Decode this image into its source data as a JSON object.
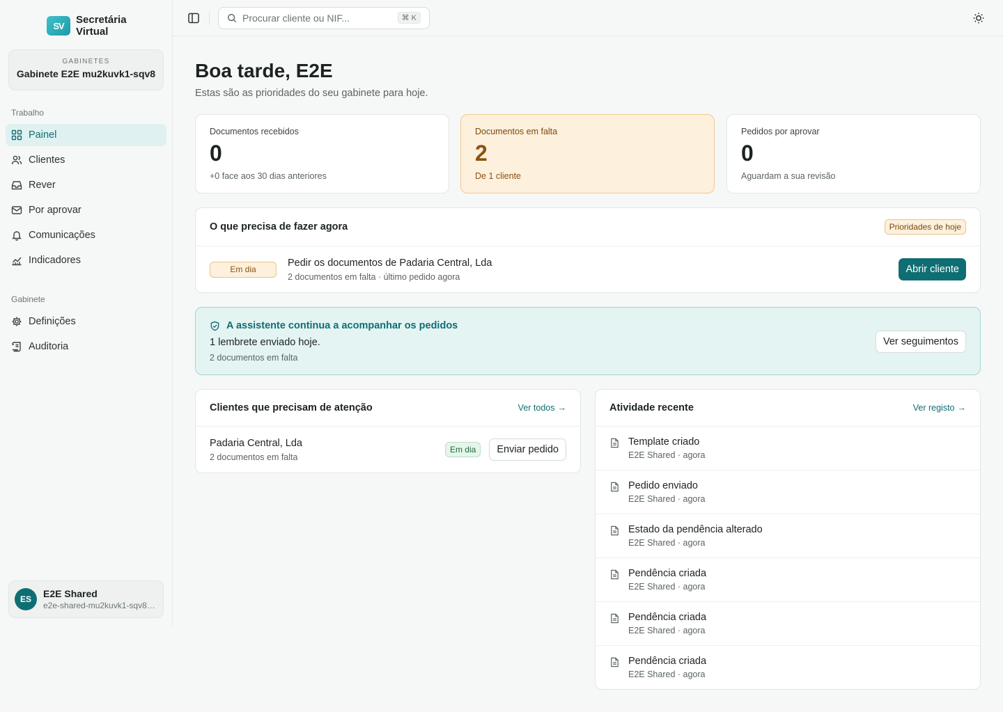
{
  "brand": {
    "logo_mark": "SV",
    "line1": "Secretária",
    "line2": "Virtual"
  },
  "office": {
    "caption": "GABINETES",
    "name": "Gabinete E2E mu2kuvk1-sqv8"
  },
  "nav": {
    "work_section": "Trabalho",
    "work_items": [
      {
        "label": "Painel",
        "icon": "grid-icon",
        "active": true
      },
      {
        "label": "Clientes",
        "icon": "users-icon"
      },
      {
        "label": "Rever",
        "icon": "inbox-icon"
      },
      {
        "label": "Por aprovar",
        "icon": "mail-icon"
      },
      {
        "label": "Comunicações",
        "icon": "bell-icon"
      },
      {
        "label": "Indicadores",
        "icon": "chart-icon"
      }
    ],
    "office_section": "Gabinete",
    "office_items": [
      {
        "label": "Definições",
        "icon": "gear-icon"
      },
      {
        "label": "Auditoria",
        "icon": "scroll-icon"
      }
    ]
  },
  "user": {
    "initials": "ES",
    "name": "E2E Shared",
    "email": "e2e-shared-mu2kuvk1-sqv8@example.com"
  },
  "header": {
    "search_placeholder": "Procurar cliente ou NIF...",
    "shortcut": "⌘ K"
  },
  "greeting": {
    "title": "Boa tarde, E2E",
    "subtitle": "Estas são as prioridades do seu gabinete para hoje."
  },
  "stats": [
    {
      "label": "Documentos recebidos",
      "value": "0",
      "hint": "+0 face aos 30 dias anteriores"
    },
    {
      "label": "Documentos em falta",
      "value": "2",
      "hint": "De 1 cliente"
    },
    {
      "label": "Pedidos por aprovar",
      "value": "0",
      "hint": "Aguardam a sua revisão"
    }
  ],
  "todo": {
    "title": "O que precisa de fazer agora",
    "badge": "Prioridades de hoje",
    "task": {
      "status": "Em dia",
      "title": "Pedir os documentos de Padaria Central, Lda",
      "sub": "2 documentos em falta · último pedido agora",
      "action": "Abrir cliente"
    }
  },
  "assistant": {
    "title": "A assistente continua a acompanhar os pedidos",
    "line": "1 lembrete enviado hoje.",
    "sub": "2 documentos em falta",
    "action": "Ver seguimentos"
  },
  "clients": {
    "title": "Clientes que precisam de atenção",
    "link": "Ver todos",
    "rows": [
      {
        "name": "Padaria Central, Lda",
        "sub": "2 documentos em falta",
        "status": "Em dia",
        "action": "Enviar pedido"
      }
    ]
  },
  "activity": {
    "title": "Atividade recente",
    "link": "Ver registo",
    "rows": [
      {
        "title": "Template criado",
        "sub": "E2E Shared · agora"
      },
      {
        "title": "Pedido enviado",
        "sub": "E2E Shared · agora"
      },
      {
        "title": "Estado da pendência alterado",
        "sub": "E2E Shared · agora"
      },
      {
        "title": "Pendência criada",
        "sub": "E2E Shared · agora"
      },
      {
        "title": "Pendência criada",
        "sub": "E2E Shared · agora"
      },
      {
        "title": "Pendência criada",
        "sub": "E2E Shared · agora"
      }
    ]
  },
  "colors": {
    "accent": "#0f6e73",
    "warning_bg": "#fdf0dd",
    "assist_bg": "#e4f4f3"
  }
}
